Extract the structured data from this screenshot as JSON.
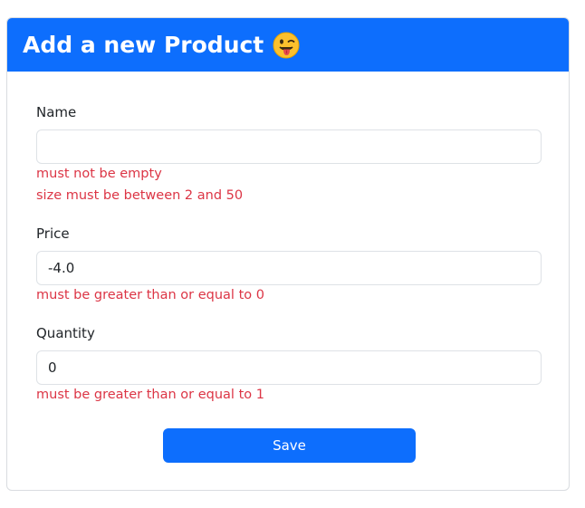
{
  "header": {
    "title": "Add a new Product",
    "emoji": "winking-face-with-tongue-icon"
  },
  "form": {
    "name": {
      "label": "Name",
      "value": "",
      "errors": [
        "must not be empty",
        "size must be between 2 and 50"
      ]
    },
    "price": {
      "label": "Price",
      "value": "-4.0",
      "errors": [
        "must be greater than or equal to 0"
      ]
    },
    "quantity": {
      "label": "Quantity",
      "value": "0",
      "errors": [
        "must be greater than or equal to 1"
      ]
    },
    "save_label": "Save"
  },
  "colors": {
    "primary": "#0d6efd",
    "error": "#dc3545",
    "text": "#212529",
    "border": "#dee2e6"
  }
}
